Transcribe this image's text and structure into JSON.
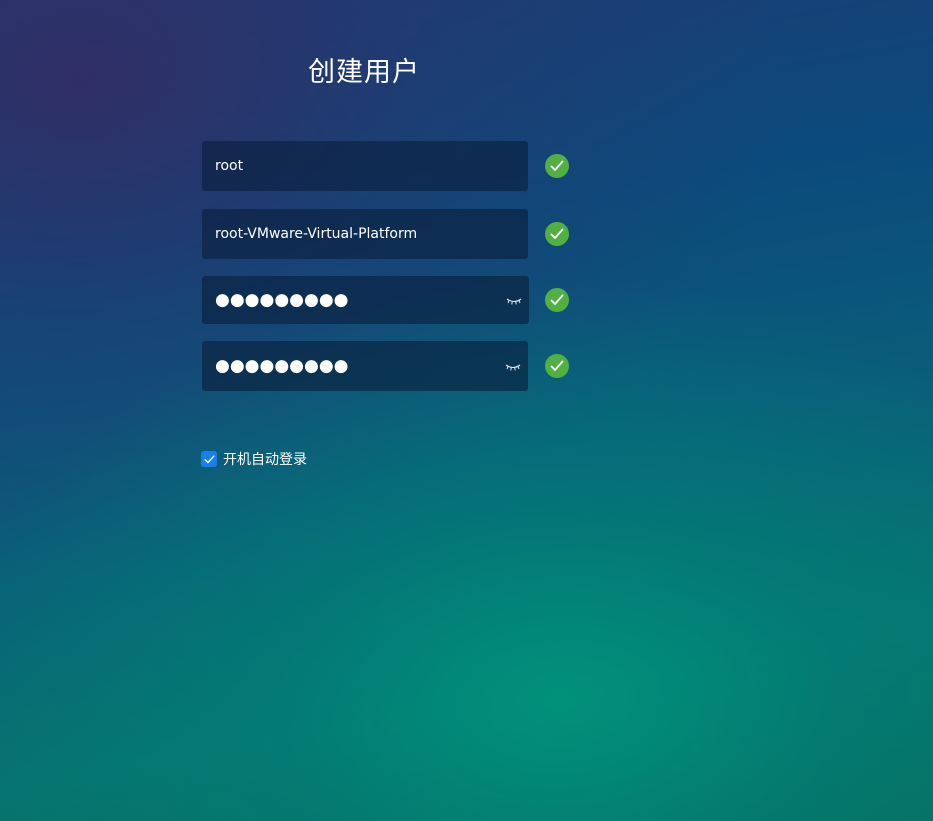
{
  "page": {
    "title": "创建用户"
  },
  "form": {
    "username": {
      "value": "root",
      "valid": true
    },
    "hostname": {
      "value": "root-VMware-Virtual-Platform",
      "valid": true
    },
    "password": {
      "masked_value": "●●●●●●●●●",
      "valid": true,
      "toggle_icon": "eye-closed-icon"
    },
    "password_confirm": {
      "masked_value": "●●●●●●●●●",
      "valid": true,
      "toggle_icon": "eye-closed-icon"
    }
  },
  "auto_login": {
    "label": "开机自动登录",
    "checked": true
  },
  "colors": {
    "valid_check": "#52b043",
    "checkbox_accent": "#1a7fea",
    "field_background": "#0a1e3c"
  }
}
